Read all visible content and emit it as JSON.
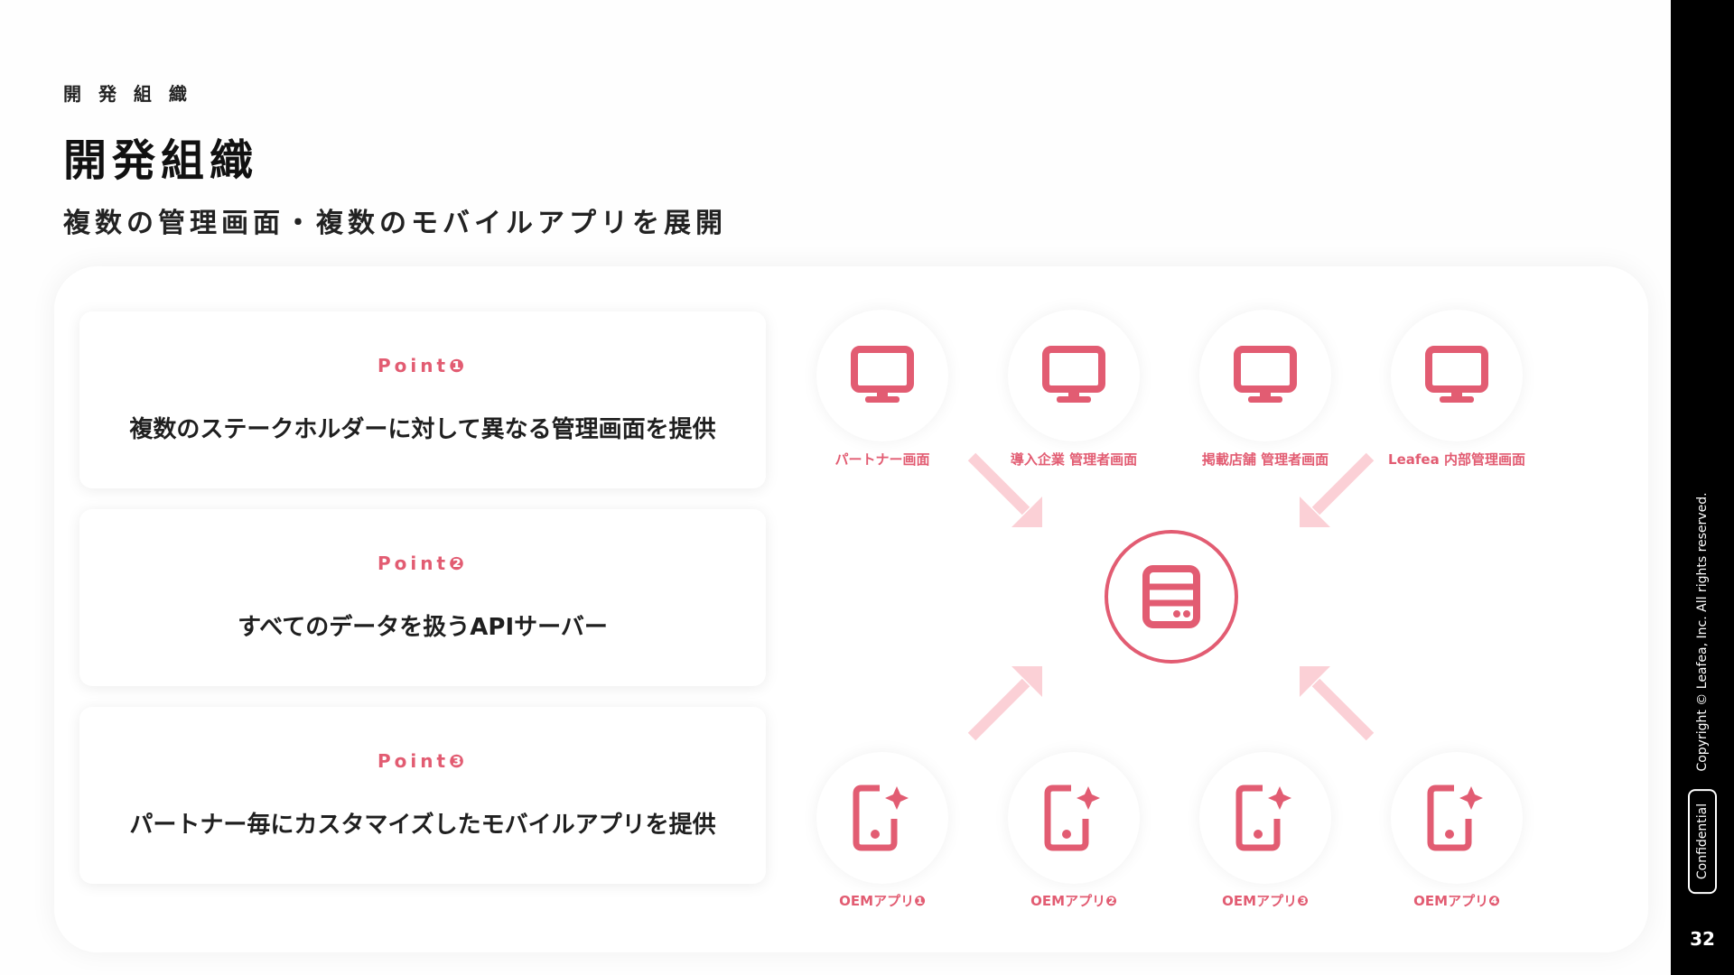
{
  "header": {
    "eyebrow": "開 発 組 織",
    "title": "開発組織",
    "subtitle": "複数の管理画面・複数のモバイルアプリを展開"
  },
  "points": [
    {
      "label": "Point❶",
      "text": "複数のステークホルダーに対して異なる管理画面を提供"
    },
    {
      "label": "Point❷",
      "text": "すべてのデータを扱うAPIサーバー"
    },
    {
      "label": "Point❸",
      "text": "パートナー毎にカスタマイズしたモバイルアプリを提供"
    }
  ],
  "diagram": {
    "admin_screens": [
      {
        "label": "パートナー画面",
        "icon": "monitor-icon"
      },
      {
        "label": "導入企業 管理者画面",
        "icon": "monitor-icon"
      },
      {
        "label": "掲載店舗 管理者画面",
        "icon": "monitor-icon"
      },
      {
        "label": "Leafea 内部管理画面",
        "icon": "monitor-icon"
      }
    ],
    "server_icon": "server-icon",
    "apps": [
      {
        "label": "OEMアプリ❶",
        "icon": "smartphone-sparkle-icon"
      },
      {
        "label": "OEMアプリ❷",
        "icon": "smartphone-sparkle-icon"
      },
      {
        "label": "OEMアプリ❸",
        "icon": "smartphone-sparkle-icon"
      },
      {
        "label": "OEMアプリ❹",
        "icon": "smartphone-sparkle-icon"
      }
    ],
    "colors": {
      "accent": "#e25c72",
      "arrow": "#fbd0d6"
    }
  },
  "sidebar": {
    "copyright": "Copyright © Leafea, Inc. All rights reserved.",
    "confidential": "Confidential",
    "page_number": "32"
  }
}
